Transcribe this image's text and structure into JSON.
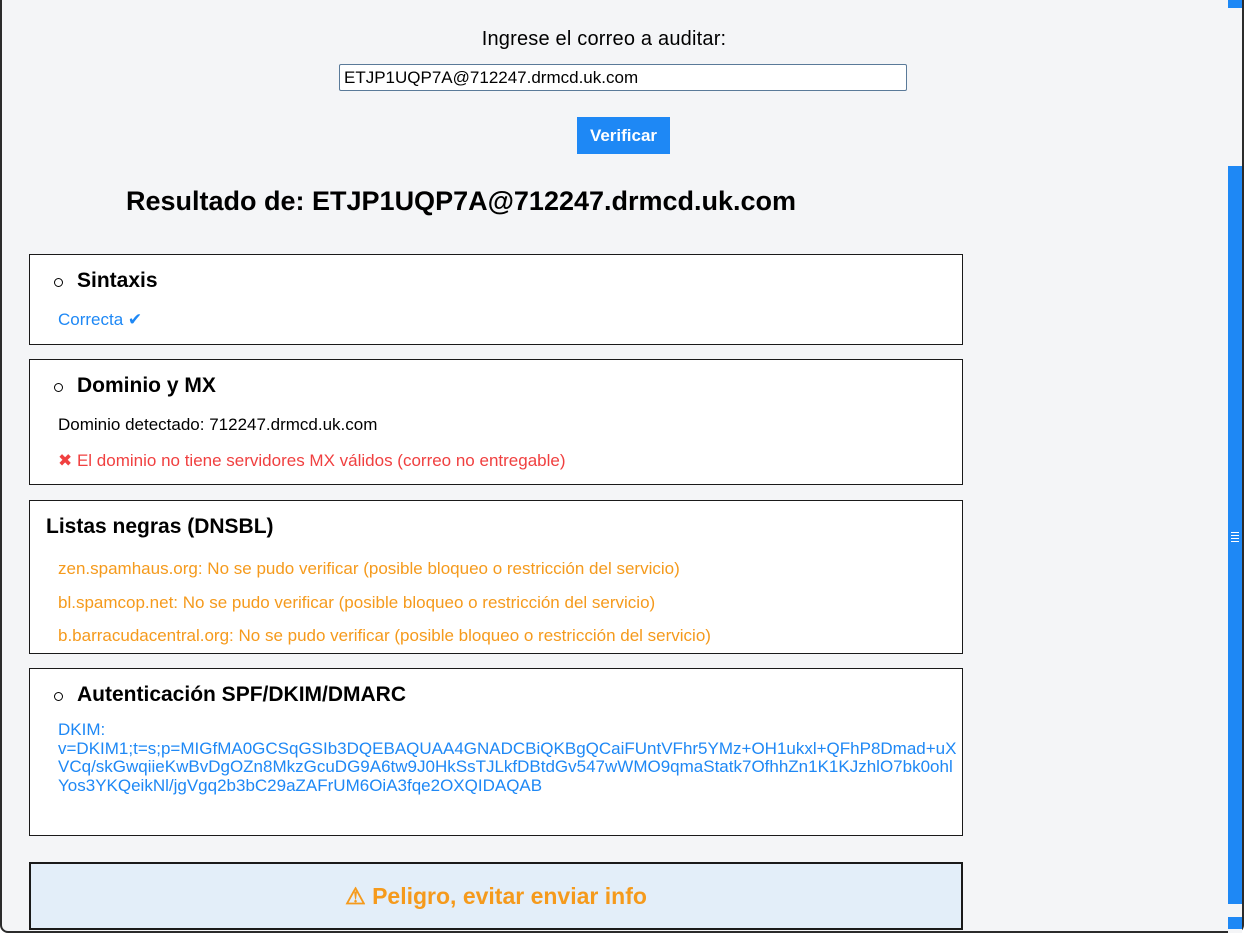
{
  "form": {
    "label": "Ingrese el correo a auditar:",
    "email_value": "ETJP1UQP7A@712247.drmcd.uk.com",
    "verify_label": "Verificar"
  },
  "result": {
    "title": "Resultado de: ETJP1UQP7A@712247.drmcd.uk.com"
  },
  "syntax": {
    "heading": "Sintaxis",
    "status": "Correcta ✔"
  },
  "domain": {
    "heading": "Dominio y MX",
    "detected": "Dominio detectado: 712247.drmcd.uk.com",
    "mx_error": "✖ El dominio no tiene servidores MX válidos (correo no entregable)"
  },
  "blacklists": {
    "heading": "Listas negras (DNSBL)",
    "items": [
      "zen.spamhaus.org: No se pudo verificar (posible bloqueo o restricción del servicio)",
      "bl.spamcop.net: No se pudo verificar (posible bloqueo o restricción del servicio)",
      "b.barracudacentral.org: No se pudo verificar (posible bloqueo o restricción del servicio)"
    ]
  },
  "auth": {
    "heading": "Autenticación SPF/DKIM/DMARC",
    "dkim_label": "DKIM:",
    "dkim_value": "v=DKIM1;t=s;p=MIGfMA0GCSqGSIb3DQEBAQUAA4GNADCBiQKBgQCaiFUntVFhr5YMz+OH1ukxl+QFhP8Dmad+uXVCq/skGwqiieKwBvDgOZn8MkzGcuDG9A6tw9J0HkSsTJLkfDBtdGv547wWMO9qmaStatk7OfhhZn1K1KJzhlO7bk0ohlYos3YKQeikNl/jgVgq2b3bC29aZAFrUM6OiA3fqe2OXQIDAQAB"
  },
  "verdict": {
    "icon": "warning-icon",
    "text": "⚠ Peligro, evitar enviar info"
  },
  "colors": {
    "accent": "#1e88f5",
    "error": "#f04040",
    "warning": "#f59a1c",
    "verdict_bg": "#e3eef9"
  }
}
